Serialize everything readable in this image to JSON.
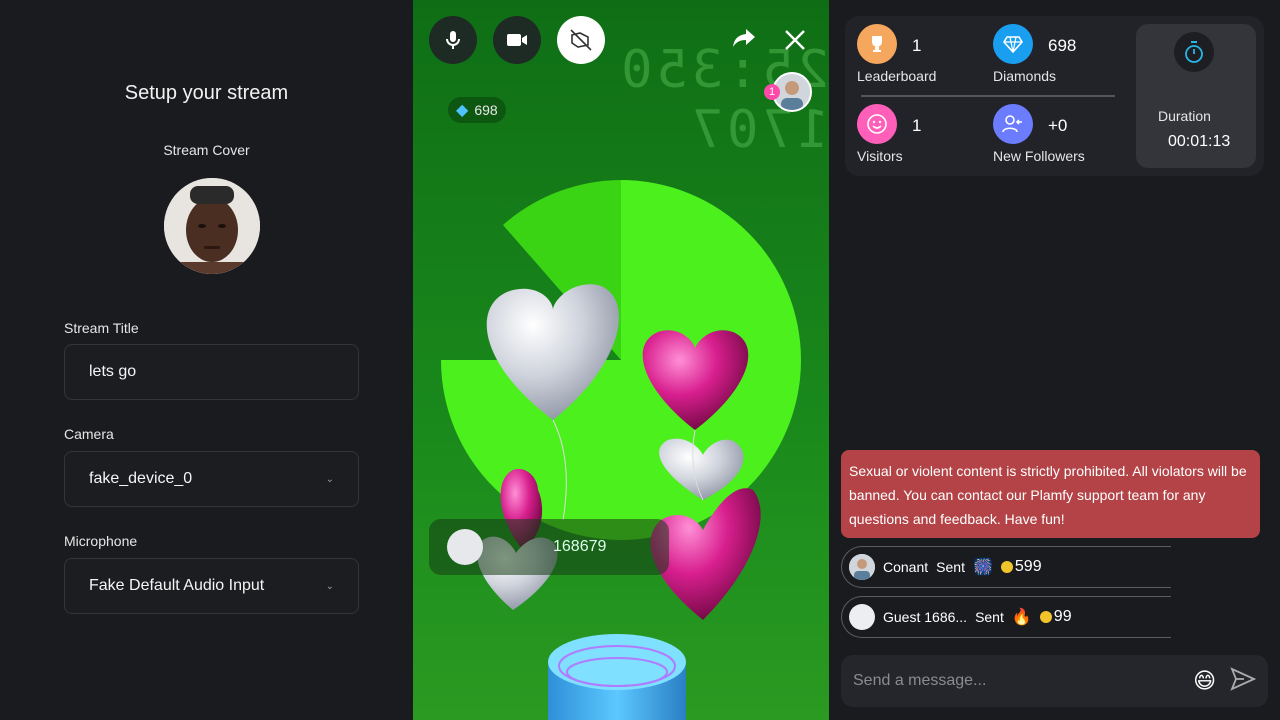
{
  "setup": {
    "title": "Setup your stream",
    "cover_label": "Stream Cover",
    "title_label": "Stream Title",
    "title_value": "lets go",
    "camera_label": "Camera",
    "camera_value": "fake_device_0",
    "mic_label": "Microphone",
    "mic_value": "Fake Default Audio Input"
  },
  "stream": {
    "diamonds": "698",
    "viewer_badge": "1",
    "bg_digits": "25:350 1707",
    "gift_text": "168679",
    "controls": [
      "mic-icon",
      "video-camera-icon",
      "effects-off-icon",
      "share-icon",
      "close-icon"
    ]
  },
  "stats": {
    "leaderboard_value": "1",
    "leaderboard_label": "Leaderboard",
    "diamonds_value": "698",
    "diamonds_label": "Diamonds",
    "visitors_value": "1",
    "visitors_label": "Visitors",
    "followers_value": "+0",
    "followers_label": "New Followers",
    "duration_label": "Duration",
    "duration_value": "00:01:13"
  },
  "chat": {
    "warning": "Sexual or violent content is strictly prohibited. All violators will be banned. You can contact our Plamfy support team for any questions and feedback. Have fun!",
    "gifts": [
      {
        "user": "Conant",
        "sent": "Sent",
        "amount": "599"
      },
      {
        "user": "Guest 1686...",
        "sent": "Sent",
        "amount": "99"
      }
    ],
    "placeholder": "Send a message..."
  },
  "colors": {
    "leaderboard": "#f5a75d",
    "diamonds": "#1a9ff0",
    "visitors": "#ff5fb8",
    "followers": "#6b7cff",
    "warning": "#b34346",
    "stream_green": "#1a8a1c"
  }
}
